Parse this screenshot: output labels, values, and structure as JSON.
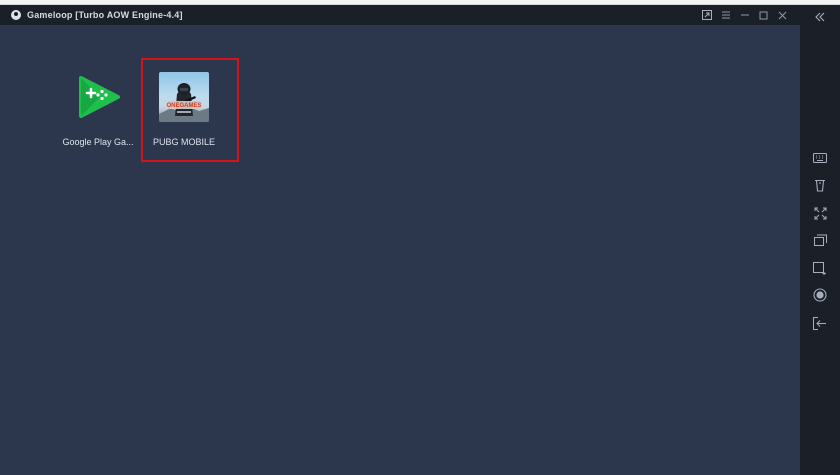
{
  "window": {
    "title": "Gameloop [Turbo AOW Engine-4.4]",
    "controls": [
      "pin-icon",
      "menu-icon",
      "minimize-icon",
      "maximize-icon",
      "close-icon"
    ]
  },
  "desktop": {
    "apps": [
      {
        "label": "Google Play Ga...",
        "icon": "google-play-games-icon"
      },
      {
        "label": "PUBG MOBILE",
        "icon": "pubg-mobile-icon",
        "highlighted": true,
        "icon_badge": "ONEGAMES"
      }
    ]
  },
  "sidebar": {
    "buttons": [
      "collapse-icon",
      "keyboard-icon",
      "shake-icon",
      "fullscreen-icon",
      "multi-window-icon",
      "screenshot-icon",
      "record-icon",
      "exit-icon"
    ]
  },
  "colors": {
    "desktop_bg": "#2c374d",
    "chrome_bg": "#1b1f28",
    "highlight": "#d6131a",
    "play_green": "#1fbf4c"
  }
}
